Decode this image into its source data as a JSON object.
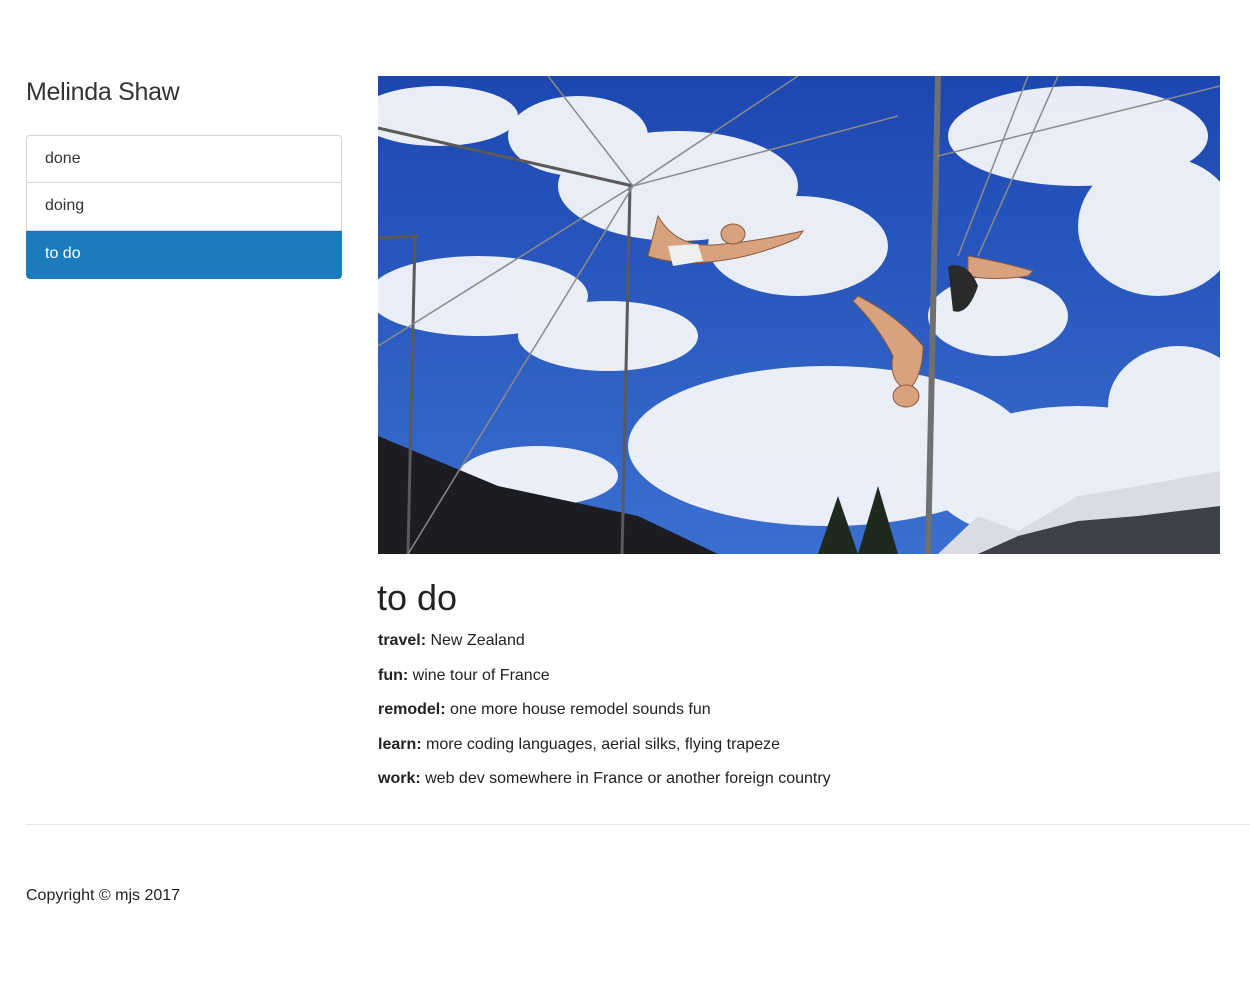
{
  "sidebar": {
    "site_title": "Melinda Shaw",
    "nav_items": [
      {
        "label": "done",
        "active": false
      },
      {
        "label": "doing",
        "active": false
      },
      {
        "label": "to do",
        "active": true
      }
    ]
  },
  "main": {
    "section_title": "to do",
    "items": [
      {
        "label": "travel:",
        "text": " New Zealand"
      },
      {
        "label": "fun:",
        "text": " wine tour of France"
      },
      {
        "label": "remodel:",
        "text": " one more house remodel sounds fun"
      },
      {
        "label": "learn:",
        "text": " more coding languages, aerial silks, flying trapeze"
      },
      {
        "label": "work:",
        "text": " web dev somewhere in France or another foreign country"
      }
    ]
  },
  "footer": {
    "copyright": "Copyright © mjs 2017"
  },
  "colors": {
    "accent": "#1a7bbd",
    "sky": "#1f4fb8"
  }
}
